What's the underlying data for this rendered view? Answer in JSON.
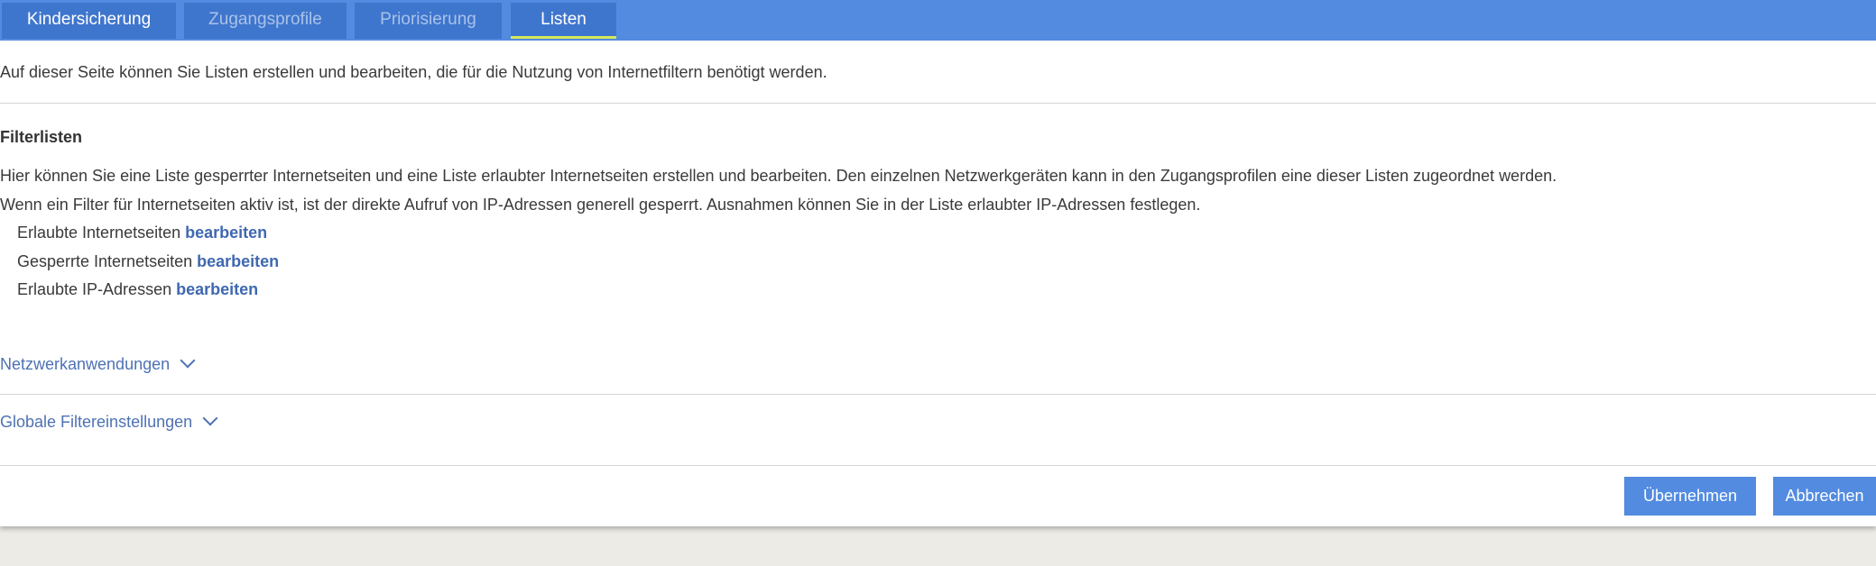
{
  "tabs": [
    {
      "label": "Kindersicherung",
      "state": "active"
    },
    {
      "label": "Zugangsprofile",
      "state": "inactive"
    },
    {
      "label": "Priorisierung",
      "state": "inactive"
    },
    {
      "label": "Listen",
      "state": "selected"
    }
  ],
  "intro_text": "Auf dieser Seite können Sie Listen erstellen und bearbeiten, die für die Nutzung von Internetfiltern benötigt werden.",
  "filterlisten": {
    "heading": "Filterlisten",
    "paragraph1": "Hier können Sie eine Liste gesperrter Internetseiten und eine Liste erlaubter Internetseiten erstellen und bearbeiten. Den einzelnen Netzwerkgeräten kann in den Zugangsprofilen eine dieser Listen zugeordnet werden.",
    "paragraph2": "Wenn ein Filter für Internetseiten aktiv ist, ist der direkte Aufruf von IP-Adressen generell gesperrt. Ausnahmen können Sie in der Liste erlaubter IP-Adressen festlegen.",
    "items": [
      {
        "label": "Erlaubte Internetseiten",
        "link": "bearbeiten"
      },
      {
        "label": "Gesperrte Internetseiten",
        "link": "bearbeiten"
      },
      {
        "label": "Erlaubte IP-Adressen",
        "link": "bearbeiten"
      }
    ]
  },
  "sections": [
    {
      "label": "Netzwerkanwendungen",
      "icon": "chevron-down-icon"
    },
    {
      "label": "Globale Filtereinstellungen",
      "icon": "chevron-down-icon"
    }
  ],
  "buttons": {
    "apply": "Übernehmen",
    "cancel": "Abbrechen"
  },
  "colors": {
    "tabbar": "#528be0",
    "tab": "#3f76cd",
    "tab_indicator": "#d4e85a",
    "link": "#3f68b0",
    "button": "#528be0"
  }
}
